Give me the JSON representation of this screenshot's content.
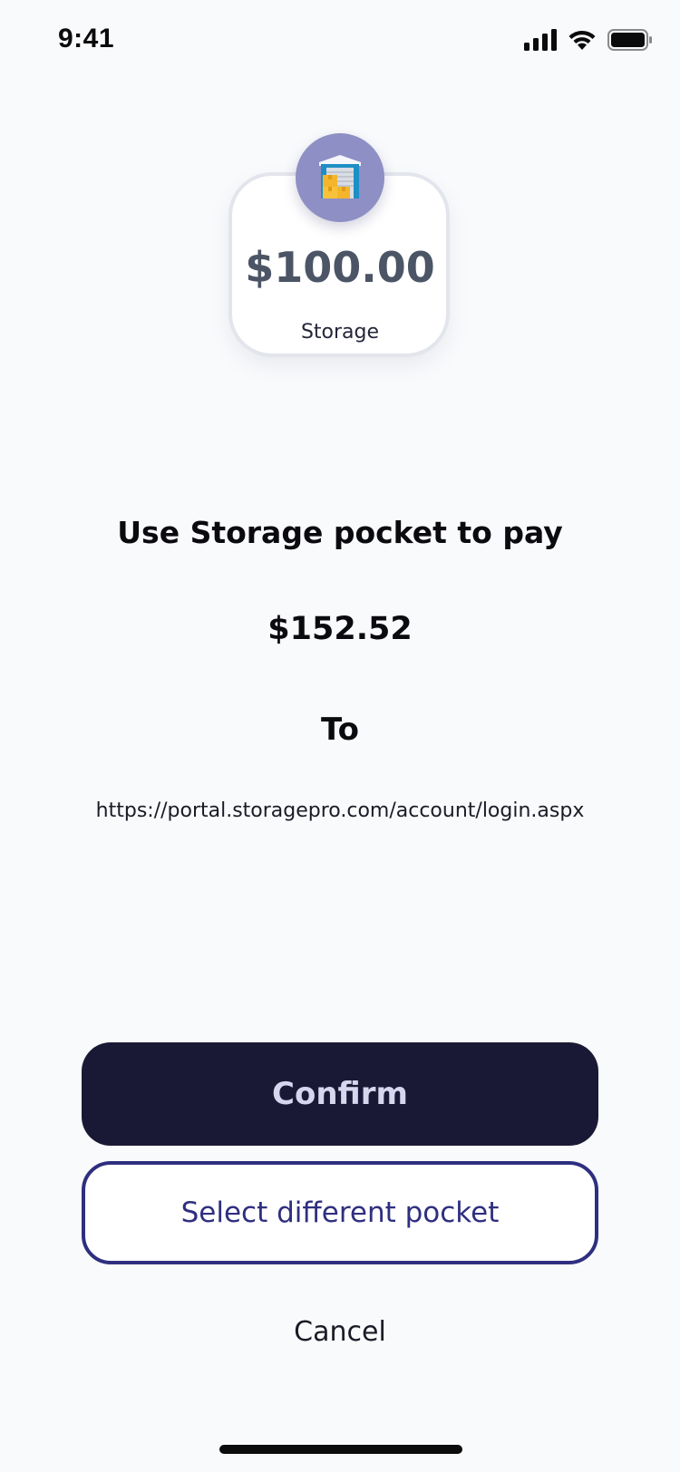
{
  "status_bar": {
    "time": "9:41",
    "icons": [
      "signal-icon",
      "wifi-icon",
      "battery-icon"
    ]
  },
  "pocket": {
    "icon": "storage-warehouse-icon",
    "balance": "$100.00",
    "name": "Storage"
  },
  "payment": {
    "prompt": "Use Storage pocket to pay",
    "amount": "$152.52",
    "to_label": "To",
    "merchant_url": "https://portal.storagepro.com/account/login.aspx"
  },
  "actions": {
    "confirm_label": "Confirm",
    "select_label": "Select different pocket",
    "cancel_label": "Cancel"
  },
  "colors": {
    "background": "#f9fafc",
    "primary_dark": "#1a1935",
    "accent": "#2f2f80",
    "avatar_bg": "#8e8fc4",
    "balance_text": "#4b5566"
  }
}
